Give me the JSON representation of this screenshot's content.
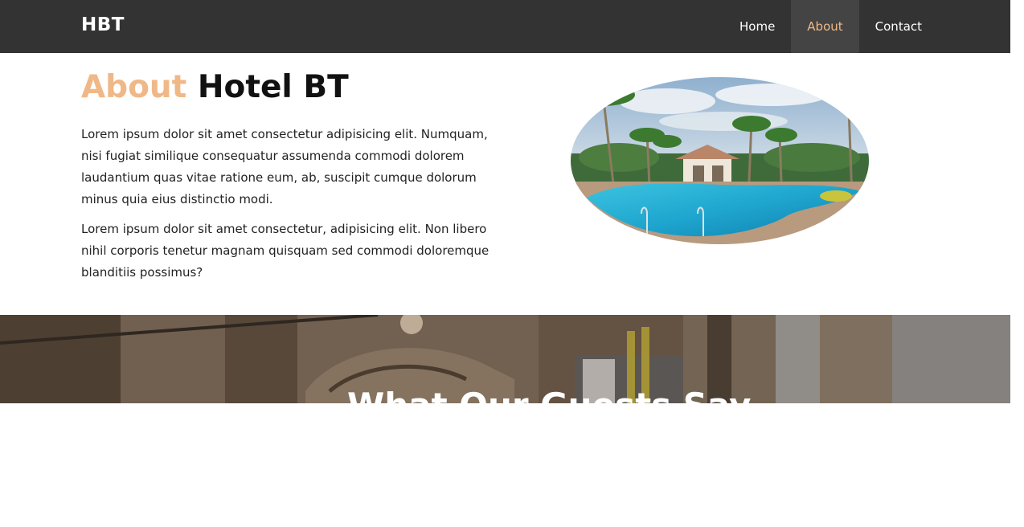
{
  "navbar": {
    "brand": "HBT",
    "links": [
      {
        "label": "Home",
        "active": false
      },
      {
        "label": "About",
        "active": true
      },
      {
        "label": "Contact",
        "active": false
      }
    ]
  },
  "about": {
    "heading_accent": "About",
    "heading_rest": "Hotel BT",
    "paragraphs": [
      "Lorem ipsum dolor sit amet consectetur adipisicing elit. Numquam, nisi fugiat similique consequatur assumenda commodi dolorem laudantium quas vitae ratione eum, ab, suscipit cumque dolorum minus quia eius distinctio modi.",
      "Lorem ipsum dolor sit amet consectetur, adipisicing elit. Non libero nihil corporis tenetur magnam quisquam sed commodi doloremque blanditiis possimus?"
    ],
    "image": "hotel-pool-photo"
  },
  "testimonials": {
    "title": "What Our Guests Say",
    "background": "hotel-exterior-photo"
  },
  "colors": {
    "navbar_bg": "#333333",
    "nav_active_bg": "#444444",
    "accent": "#f0b887",
    "text": "#222222"
  }
}
